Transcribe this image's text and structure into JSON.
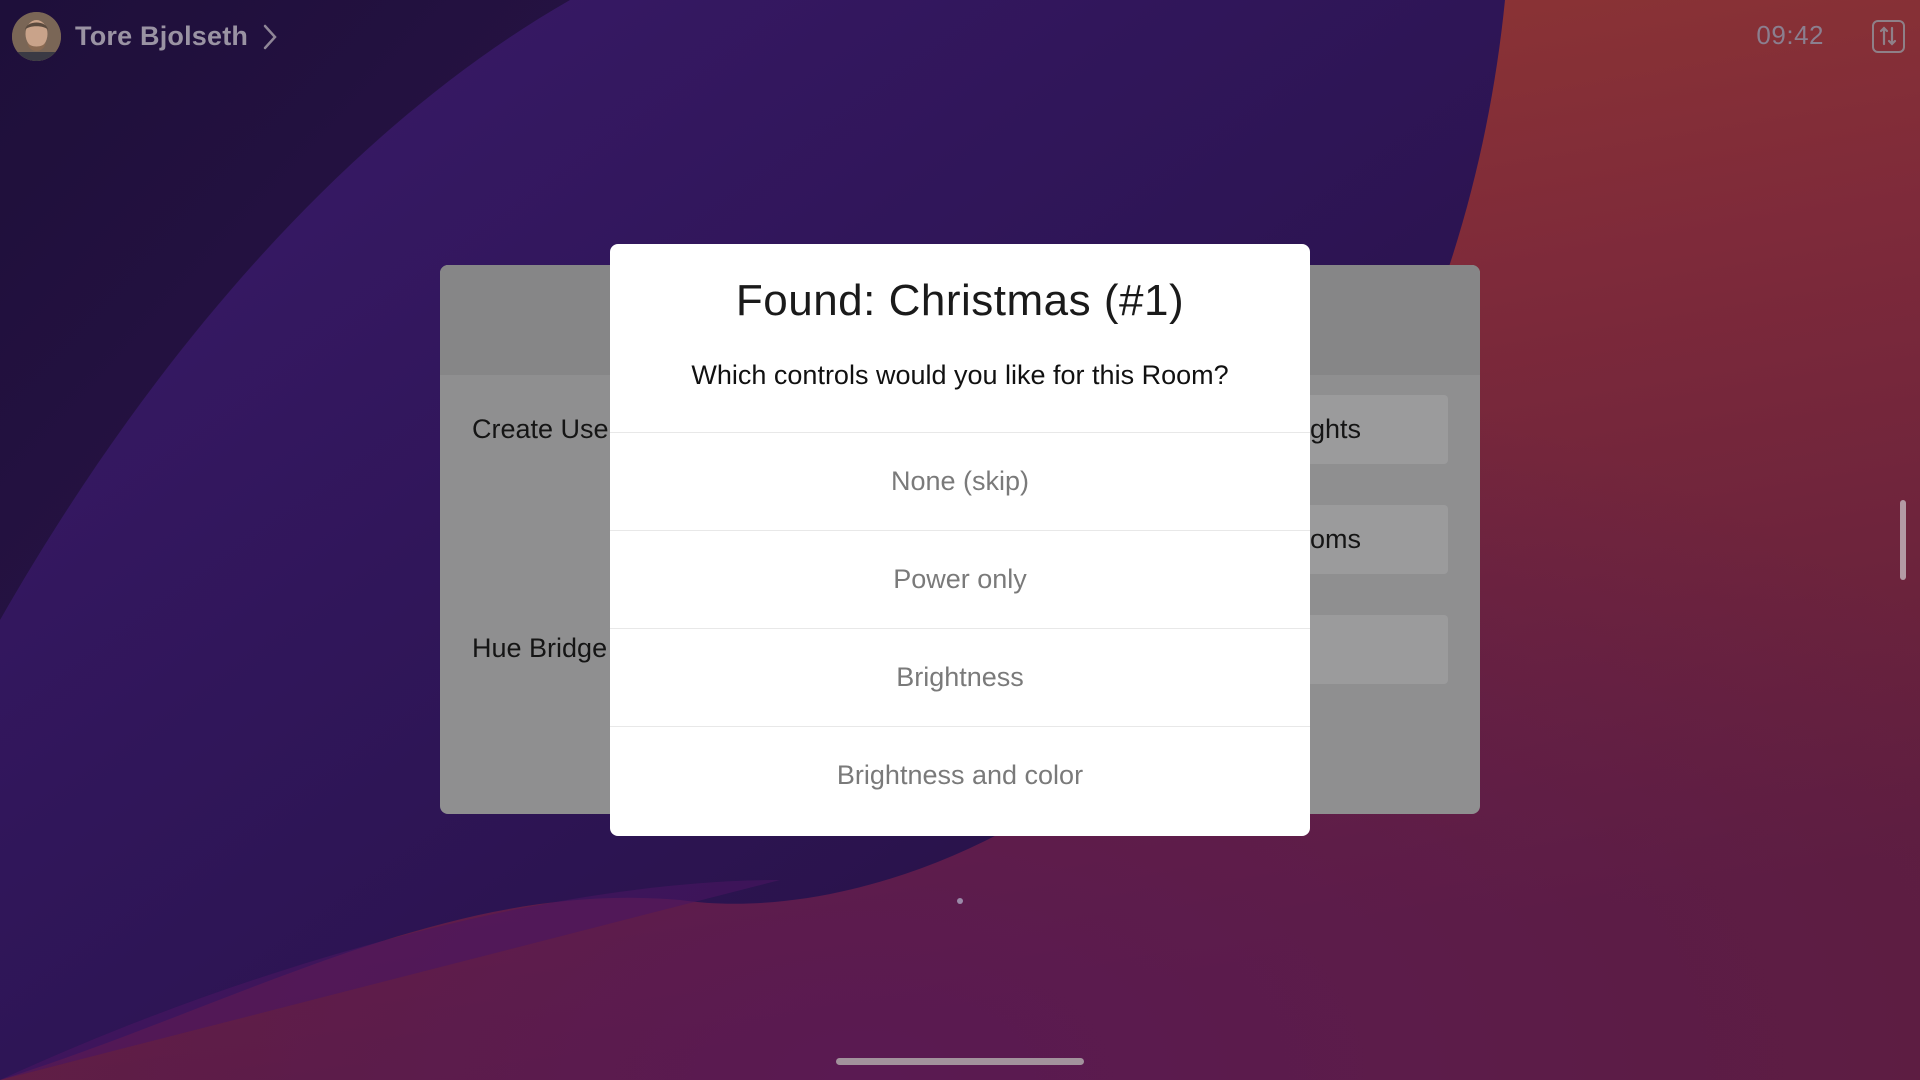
{
  "header": {
    "user_name": "Tore Bjolseth",
    "clock": "09:42",
    "avatar_icon": "user-avatar",
    "chevron_icon": "chevron-right-icon",
    "tools_icon": "sliders-icon"
  },
  "background_panel": {
    "left_labels": [
      "Create User",
      "Hue Bridge"
    ],
    "right_buttons": [
      "ghts",
      "oms",
      ""
    ]
  },
  "dialog": {
    "title": "Found: Christmas (#1)",
    "subtitle": "Which controls would you like for this Room?",
    "options": [
      {
        "label": "None (skip)"
      },
      {
        "label": "Power only"
      },
      {
        "label": "Brightness"
      },
      {
        "label": "Brightness and color"
      }
    ]
  },
  "colors": {
    "bg_dark": "#1d0f3b",
    "bg_purple": "#3a1666",
    "bg_red": "#8e3430",
    "modal_bg": "#ffffff",
    "option_text": "#7a7a7a"
  }
}
